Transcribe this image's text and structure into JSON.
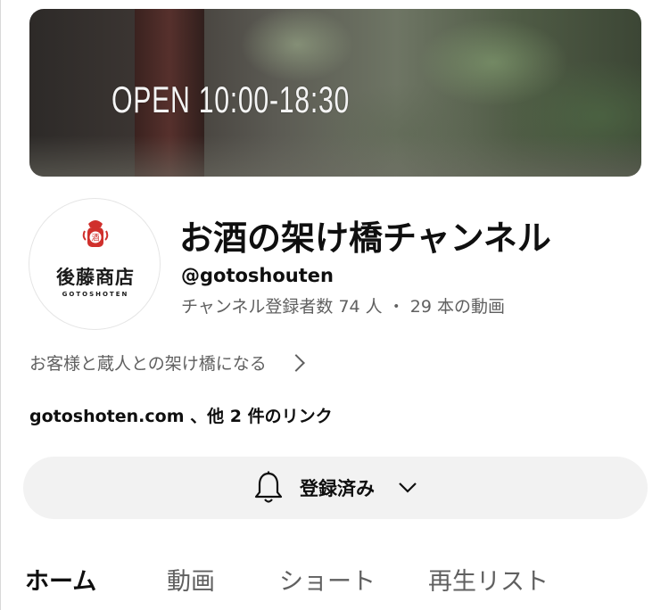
{
  "banner": {
    "hours_text": "OPEN 10:00-18:30"
  },
  "avatar": {
    "logo_text": "後藤商店",
    "logo_subtext": "GOTOSHOTEN",
    "logo_mark_text": "酒",
    "accent": "#d0302c"
  },
  "channel": {
    "name": "お酒の架け橋チャンネル",
    "handle": "@gotoshouten",
    "stats": "チャンネル登録者数 74 人 ・ 29 本の動画",
    "description": "お客様と蔵人との架け橋になる",
    "links": "gotoshoten.com 、他 2 件のリンク"
  },
  "subscribe": {
    "label": "登録済み",
    "icon": "bell-icon",
    "menu_icon": "chevron-down-icon"
  },
  "tabs": [
    {
      "label": "ホーム",
      "active": true
    },
    {
      "label": "動画",
      "active": false
    },
    {
      "label": "ショート",
      "active": false
    },
    {
      "label": "再生リスト",
      "active": false
    }
  ]
}
